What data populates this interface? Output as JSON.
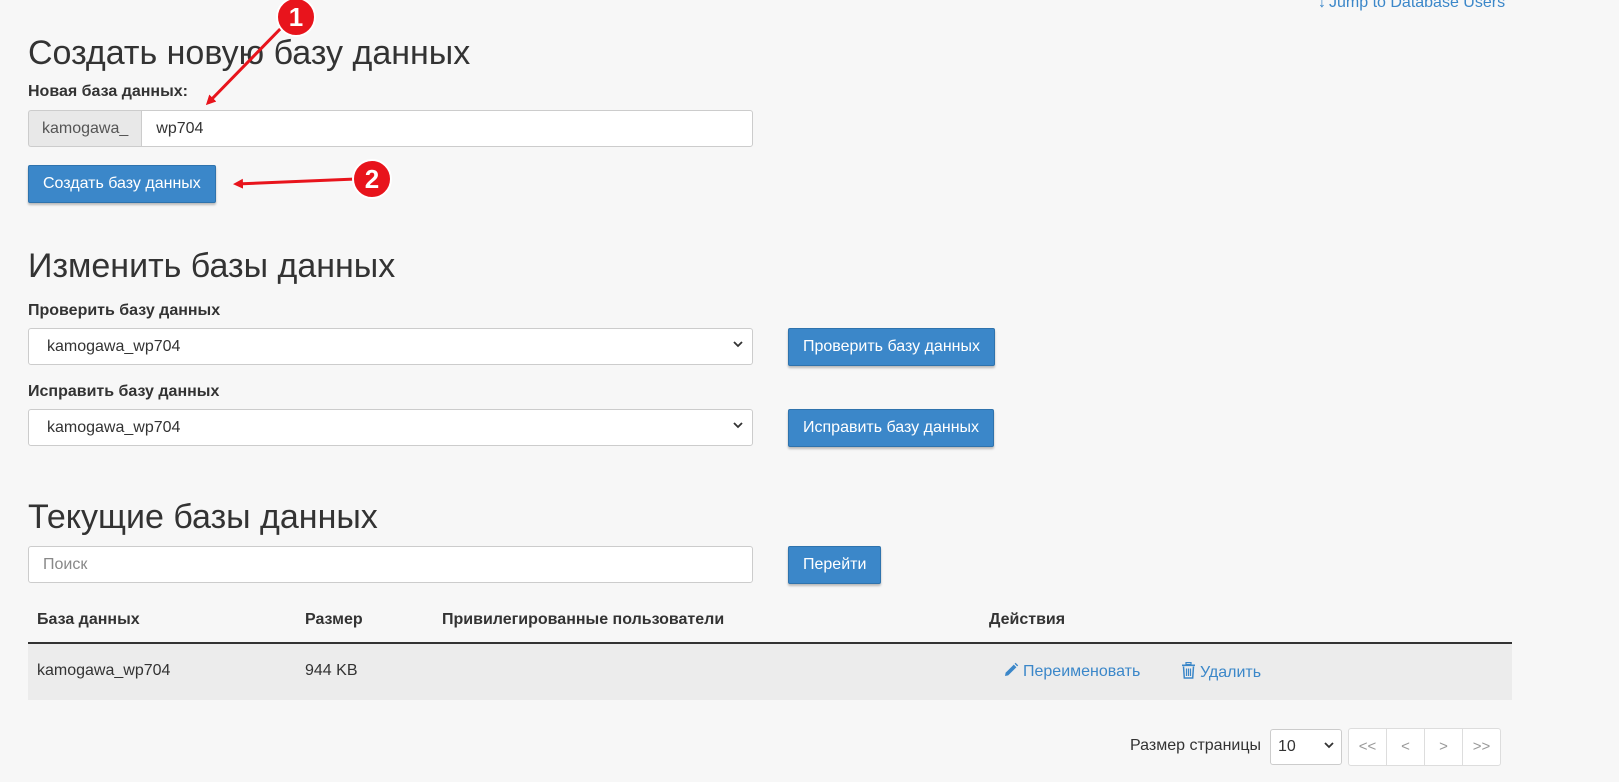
{
  "jump_link": {
    "arrow": "↓",
    "label": "Jump to Database Users"
  },
  "create_section": {
    "title": "Создать новую базу данных",
    "field_label": "Новая база данных:",
    "prefix": "kamogawa_",
    "input_value": "wp704",
    "submit_label": "Создать базу данных"
  },
  "modify_section": {
    "title": "Изменить базы данных",
    "check": {
      "label": "Проверить базу данных",
      "selected": "kamogawa_wp704",
      "button": "Проверить базу данных"
    },
    "repair": {
      "label": "Исправить базу данных",
      "selected": "kamogawa_wp704",
      "button": "Исправить базу данных"
    }
  },
  "current_section": {
    "title": "Текущие базы данных",
    "search_placeholder": "Поиск",
    "go_button": "Перейти",
    "table": {
      "headers": {
        "database": "База данных",
        "size": "Размер",
        "users": "Привилегированные пользователи",
        "actions": "Действия"
      },
      "rows": [
        {
          "database": "kamogawa_wp704",
          "size": "944 KB",
          "users": "",
          "rename": "Переименовать",
          "delete": "Удалить"
        }
      ]
    },
    "pagination": {
      "page_size_label": "Размер страницы",
      "page_size": "10",
      "first": "<<",
      "prev": "<",
      "next": ">",
      "last": ">>"
    }
  },
  "annotations": {
    "marker_1": "1",
    "marker_2": "2",
    "color": "#e8141c"
  },
  "colors": {
    "accent": "#3b87c9",
    "background": "#f7f7f7"
  }
}
